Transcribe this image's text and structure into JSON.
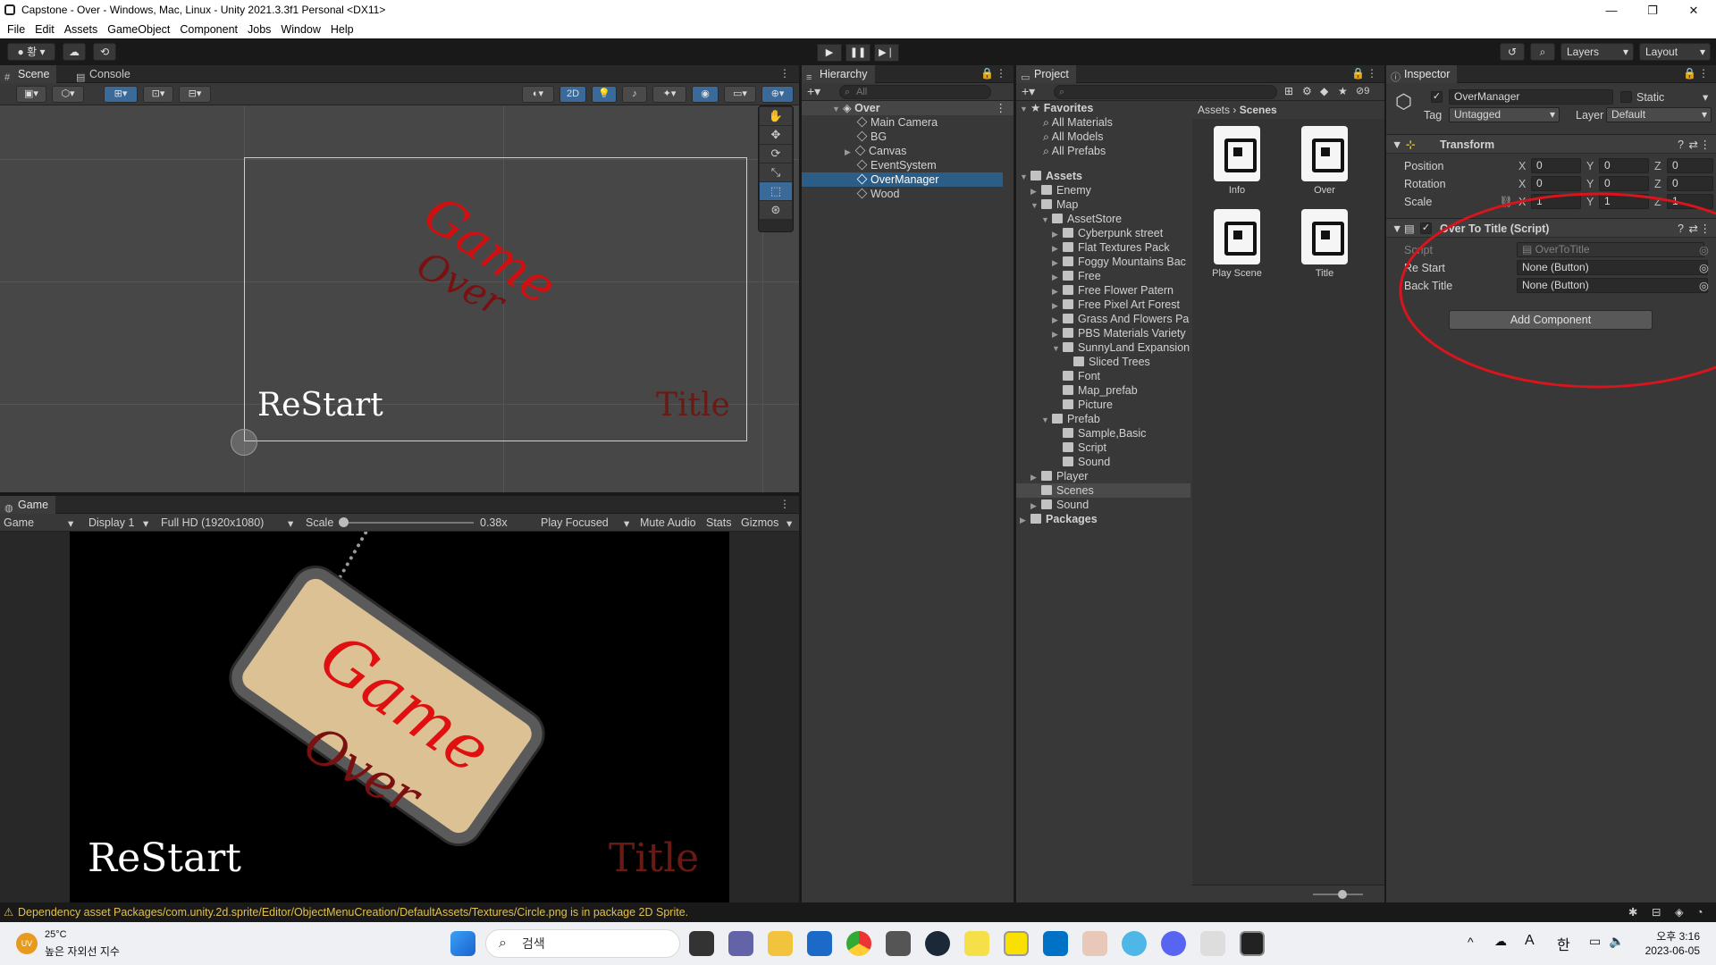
{
  "window": {
    "title": "Capstone - Over - Windows, Mac, Linux - Unity 2021.3.3f1 Personal <DX11>",
    "controls": [
      "—",
      "❐",
      "✕"
    ]
  },
  "menu": [
    "File",
    "Edit",
    "Assets",
    "GameObject",
    "Component",
    "Jobs",
    "Window",
    "Help"
  ],
  "toolbar": {
    "account_label": "황",
    "layers_label": "Layers",
    "layout_label": "Layout"
  },
  "scene_panel": {
    "tabs": [
      "Scene",
      "Console"
    ],
    "mode_2d": "2D",
    "labels": {
      "restart": "ReStart",
      "title": "Title",
      "game": "Game",
      "over": "Over"
    }
  },
  "game_panel": {
    "tab": "Game",
    "display_mode": "Game",
    "display": "Display 1",
    "resolution": "Full HD (1920x1080)",
    "scale_label": "Scale",
    "scale_value": "0.38x",
    "scale_fraction": 0.0,
    "play_mode": "Play Focused",
    "mute": "Mute Audio",
    "stats": "Stats",
    "gizmos": "Gizmos",
    "labels": {
      "restart": "ReStart",
      "title": "Title",
      "game": "Game",
      "over": "Over"
    }
  },
  "hierarchy": {
    "tab": "Hierarchy",
    "search_placeholder": "All",
    "scene": "Over",
    "items": [
      "Main Camera",
      "BG",
      "Canvas",
      "EventSystem",
      "OverManager",
      "Wood"
    ],
    "selected": "OverManager"
  },
  "project": {
    "tab": "Project",
    "favorites_label": "Favorites",
    "favorites": [
      "All Materials",
      "All Models",
      "All Prefabs"
    ],
    "assets_label": "Assets",
    "tree": [
      "Enemy",
      "Map",
      "AssetStore",
      "Cyberpunk street",
      "Flat Textures Pack",
      "Foggy Mountains Bac",
      "Free",
      "Free Flower Patern",
      "Free Pixel Art Forest",
      "Grass And Flowers Pa",
      "PBS Materials Variety",
      "SunnyLand Expansion",
      "Sliced Trees",
      "Font",
      "Map_prefab",
      "Picture",
      "Prefab",
      "Sample,Basic",
      "Script",
      "Sound",
      "Player",
      "Scenes",
      "Sound",
      "Packages"
    ],
    "breadcrumb": [
      "Assets",
      "Scenes"
    ],
    "files": [
      "Info",
      "Over",
      "Play Scene",
      "Title"
    ],
    "hidden_count": "9"
  },
  "inspector": {
    "tab": "Inspector",
    "object_name": "OverManager",
    "static_label": "Static",
    "tag_label": "Tag",
    "tag_value": "Untagged",
    "layer_label": "Layer",
    "layer_value": "Default",
    "transform": {
      "header": "Transform",
      "position_label": "Position",
      "rotation_label": "Rotation",
      "scale_label": "Scale",
      "position": [
        "0",
        "0",
        "0"
      ],
      "rotation": [
        "0",
        "0",
        "0"
      ],
      "scale": [
        "1",
        "1",
        "1"
      ],
      "axis": [
        "X",
        "Y",
        "Z"
      ]
    },
    "script_component": {
      "header": "Over To Title (Script)",
      "script_label": "Script",
      "script_value": "OverToTitle",
      "restart_label": "Re Start",
      "restart_value": "None (Button)",
      "back_label": "Back Title",
      "back_value": "None (Button)"
    },
    "add_component": "Add Component",
    "annotation_color": "#d8141c"
  },
  "status": {
    "message": "Dependency asset Packages/com.unity.2d.sprite/Editor/ObjectMenuCreation/DefaultAssets/Textures/Circle.png is in package 2D Sprite."
  },
  "taskbar": {
    "weather_temp": "25°C",
    "weather_desc": "높은 자외선 지수",
    "uv_badge": "UV",
    "search_text": "검색",
    "ime_a": "A",
    "ime_han": "한",
    "time": "오후 3:16",
    "date": "2023-06-05"
  },
  "colors": {
    "accent_selection": "#2c5d87",
    "game_red": "#d01010",
    "over_dark": "#7a1010",
    "warning": "#e0c050"
  }
}
